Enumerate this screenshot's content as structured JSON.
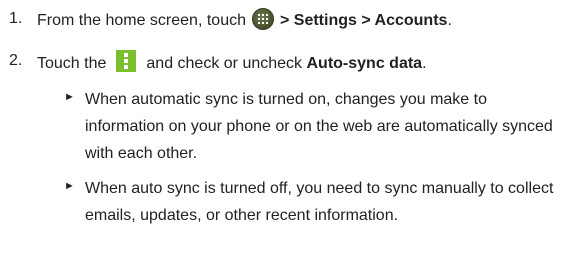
{
  "steps": [
    {
      "number": "1.",
      "text_before_icon": "From the home screen, touch",
      "icon": "apps-launcher-icon",
      "text_after_icon_bold": "> Settings > Accounts",
      "text_end": "."
    },
    {
      "number": "2.",
      "text_before_icon": "Touch the",
      "icon": "menu-overflow-icon",
      "text_after_icon": "and check or uncheck",
      "text_bold": "Auto-sync data",
      "text_end": "."
    }
  ],
  "bullets": [
    {
      "marker": "►",
      "text": "When automatic sync is turned on, changes you make to information on your phone or on the web are automatically synced with each other."
    },
    {
      "marker": "►",
      "text": "When auto sync is turned off, you need to sync manually to collect emails, updates, or other recent information."
    }
  ],
  "colors": {
    "text": "#222222",
    "menu_icon": "#7bbf2f",
    "apps_icon": "#4b5430"
  }
}
